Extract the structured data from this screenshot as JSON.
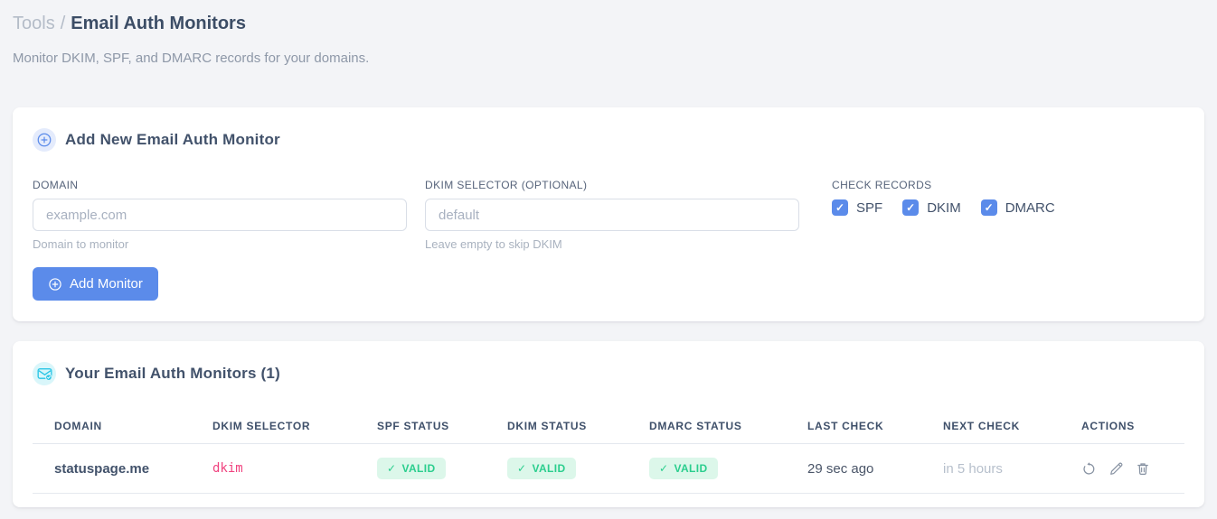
{
  "breadcrumb": {
    "section": "Tools",
    "separator": "/",
    "title": "Email Auth Monitors"
  },
  "subtitle": "Monitor DKIM, SPF, and DMARC records for your domains.",
  "icons": {
    "check_glyph": "✓",
    "add_card_badge": "circle-plus",
    "list_card_badge": "envelope-check",
    "actions": [
      "refresh",
      "edit",
      "delete"
    ]
  },
  "colors": {
    "accent_blue": "#5b8bea",
    "success_text": "#2bce8e",
    "success_bg": "#dcf7ea",
    "selector_pink": "#f0437f",
    "badge_cyan": "#29c5e6",
    "page_bg": "#f3f4f7"
  },
  "add_card": {
    "title": "Add New Email Auth Monitor",
    "fields": {
      "domain": {
        "label": "DOMAIN",
        "value": "",
        "placeholder": "example.com",
        "helper": "Domain to monitor"
      },
      "dkim_selector": {
        "label": "DKIM SELECTOR (OPTIONAL)",
        "value": "",
        "placeholder": "default",
        "helper": "Leave empty to skip DKIM"
      }
    },
    "check_records": {
      "label": "CHECK RECORDS",
      "options": [
        {
          "label": "SPF",
          "checked": true
        },
        {
          "label": "DKIM",
          "checked": true
        },
        {
          "label": "DMARC",
          "checked": true
        }
      ]
    },
    "submit_label": "Add Monitor"
  },
  "monitors_card": {
    "title": "Your Email Auth Monitors (1)",
    "count": 1,
    "table": {
      "columns": [
        "DOMAIN",
        "DKIM SELECTOR",
        "SPF STATUS",
        "DKIM STATUS",
        "DMARC STATUS",
        "LAST CHECK",
        "NEXT CHECK",
        "ACTIONS"
      ],
      "rows": [
        {
          "domain": "statuspage.me",
          "dkim_selector": "dkim",
          "spf_status": "VALID",
          "dkim_status": "VALID",
          "dmarc_status": "VALID",
          "last_check": "29 sec ago",
          "next_check": "in 5 hours"
        }
      ]
    }
  }
}
